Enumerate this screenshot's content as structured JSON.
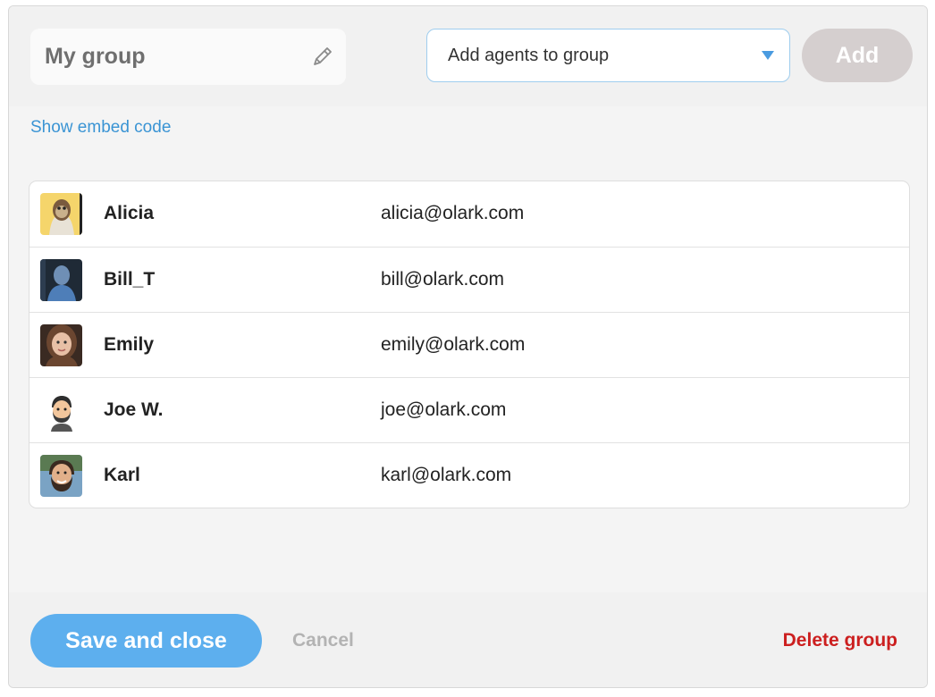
{
  "header": {
    "group_name": "My group",
    "agents_select": {
      "placeholder": "Add agents to group"
    },
    "add_label": "Add"
  },
  "embed_link": "Show embed code",
  "agents": [
    {
      "name": "Alicia",
      "email": "alicia@olark.com"
    },
    {
      "name": "Bill_T",
      "email": "bill@olark.com"
    },
    {
      "name": "Emily",
      "email": "emily@olark.com"
    },
    {
      "name": "Joe W.",
      "email": "joe@olark.com"
    },
    {
      "name": "Karl",
      "email": "karl@olark.com"
    }
  ],
  "footer": {
    "save_label": "Save and close",
    "cancel_label": "Cancel",
    "delete_label": "Delete group"
  },
  "colors": {
    "accent": "#5dafee",
    "link": "#3a94d4",
    "danger": "#cc1f1f",
    "disabled_button": "#d5cfcf"
  }
}
